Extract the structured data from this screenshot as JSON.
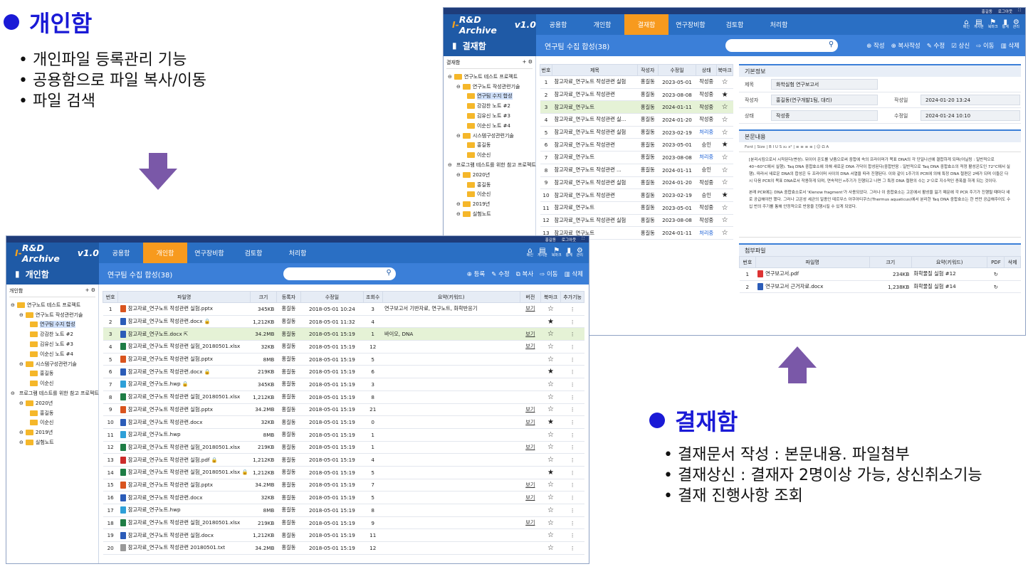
{
  "slide": {
    "personal_title": "개인함",
    "personal_bullets": [
      "개인파일 등록관리 기능",
      "공용함으로 파일 복사/이동",
      "파일 검색"
    ],
    "approval_title": "결재함",
    "approval_bullets": [
      "결재문서 작성 : 본문내용. 파일첨부",
      "결재상신 : 결재자 2명이상 가능, 상신취소기능",
      "결재 진행사항 조회"
    ]
  },
  "app": {
    "logo_prefix": "I-",
    "logo_main": "R&D Archive",
    "logo_ver": "v1.0",
    "user": "홍길동",
    "logout": "로그아웃"
  },
  "nav_personal": [
    "공용함",
    "개인함",
    "연구장비함",
    "검토함",
    "처리함"
  ],
  "nav_approval": [
    "공용함",
    "개인함",
    "결재함",
    "연구장비함",
    "검토함",
    "처리함"
  ],
  "navicons": [
    {
      "icon": "home-icon",
      "glyph": "⌂",
      "label": "메인"
    },
    {
      "icon": "board-icon",
      "glyph": "▤",
      "label": "게시판"
    },
    {
      "icon": "bookmark-icon",
      "glyph": "⚑",
      "label": "북마크"
    },
    {
      "icon": "stats-icon",
      "glyph": "▮",
      "label": "통계"
    },
    {
      "icon": "gear-icon",
      "glyph": "⚙",
      "label": "관리"
    }
  ],
  "personal": {
    "section": "개인함",
    "subtitle": "연구팀 수집 합성(38)",
    "toolbar": [
      "등록",
      "수정",
      "복사",
      "이동",
      "삭제"
    ],
    "tree_header": "개인함",
    "tree": [
      {
        "d": 0,
        "t": "연구노트 테스트 프로젝트"
      },
      {
        "d": 1,
        "t": "연구노트 작성관련기술"
      },
      {
        "d": 2,
        "t": "연구팀 수지 합성",
        "sel": true
      },
      {
        "d": 2,
        "t": "강감찬 노트 #2"
      },
      {
        "d": 2,
        "t": "김유신 노트 #3"
      },
      {
        "d": 2,
        "t": "이순신 노트 #4"
      },
      {
        "d": 1,
        "t": "시스템구성관련기술"
      },
      {
        "d": 2,
        "t": "홍길동"
      },
      {
        "d": 2,
        "t": "이순신"
      },
      {
        "d": 0,
        "t": "프로그램 테스트를 위한 참고 프로젝트"
      },
      {
        "d": 1,
        "t": "2020년"
      },
      {
        "d": 2,
        "t": "홍길동"
      },
      {
        "d": 2,
        "t": "이순신"
      },
      {
        "d": 1,
        "t": "2019년"
      },
      {
        "d": 1,
        "t": "실험노트"
      }
    ],
    "columns": [
      "번호",
      "파일명",
      "크기",
      "등록자",
      "수정일",
      "조회수",
      "요약(키워드)",
      "버전",
      "북마크",
      "추가기능"
    ],
    "rows": [
      [
        "1",
        "참고자료_연구노트 작성관련 실험.pptx",
        "345KB",
        "홍길동",
        "2018-05-01 10:24",
        "3",
        "연구보고서 기반자료, 연구노트, 화학반응기",
        "보기",
        "☆",
        "p",
        ""
      ],
      [
        "2",
        "참고자료_연구노트 작성관련.docx",
        "1,212KB",
        "홍길동",
        "2018-05-01 11:32",
        "4",
        "",
        "",
        "★",
        "w",
        "lock"
      ],
      [
        "3",
        "참고자료_연구노트.docx",
        "34.2MB",
        "홍길동",
        "2018-05-01 15:19",
        "1",
        "바이오, DNA",
        "보기",
        "☆",
        "w",
        "share"
      ],
      [
        "4",
        "참고자료_연구노트 작성관련 실험_20180501.xlsx",
        "32KB",
        "홍길동",
        "2018-05-01 15:19",
        "12",
        "",
        "보기",
        "☆",
        "x",
        ""
      ],
      [
        "5",
        "참고자료_연구노트 작성관련 실험.pptx",
        "8MB",
        "홍길동",
        "2018-05-01 15:19",
        "5",
        "",
        "",
        "☆",
        "p",
        ""
      ],
      [
        "6",
        "참고자료_연구노트 작성관련.docx",
        "219KB",
        "홍길동",
        "2018-05-01 15:19",
        "6",
        "",
        "",
        "★",
        "w",
        "lock"
      ],
      [
        "7",
        "참고자료_연구노트.hwp",
        "345KB",
        "홍길동",
        "2018-05-01 15:19",
        "3",
        "",
        "",
        "☆",
        "h",
        "lock"
      ],
      [
        "8",
        "참고자료_연구노트 작성관련 실험_20180501.xlsx",
        "1,212KB",
        "홍길동",
        "2018-05-01 15:19",
        "8",
        "",
        "",
        "☆",
        "x",
        ""
      ],
      [
        "9",
        "참고자료_연구노트 작성관련 실험.pptx",
        "34.2MB",
        "홍길동",
        "2018-05-01 15:19",
        "21",
        "",
        "보기",
        "☆",
        "p",
        ""
      ],
      [
        "10",
        "참고자료_연구노트 작성관련.docx",
        "32KB",
        "홍길동",
        "2018-05-01 15:19",
        "0",
        "",
        "보기",
        "★",
        "w",
        ""
      ],
      [
        "11",
        "참고자료_연구노트.hwp",
        "8MB",
        "홍길동",
        "2018-05-01 15:19",
        "1",
        "",
        "",
        "☆",
        "h",
        ""
      ],
      [
        "12",
        "참고자료_연구노트 작성관련 실험_20180501.xlsx",
        "219KB",
        "홍길동",
        "2018-05-01 15:19",
        "1",
        "",
        "보기",
        "☆",
        "x",
        ""
      ],
      [
        "13",
        "참고자료_연구노트 작성관련 실험.pdf",
        "1,212KB",
        "홍길동",
        "2018-05-01 15:19",
        "4",
        "",
        "",
        "☆",
        "pdf",
        "lock"
      ],
      [
        "14",
        "참고자료_연구노트 작성관련 실험_20180501.xlsx",
        "1,212KB",
        "홍길동",
        "2018-05-01 15:19",
        "5",
        "",
        "",
        "★",
        "x",
        "lock"
      ],
      [
        "15",
        "참고자료_연구노트 작성관련 실험.pptx",
        "34.2MB",
        "홍길동",
        "2018-05-01 15:19",
        "7",
        "",
        "보기",
        "☆",
        "p",
        ""
      ],
      [
        "16",
        "참고자료_연구노트 작성관련.docx",
        "32KB",
        "홍길동",
        "2018-05-01 15:19",
        "5",
        "",
        "보기",
        "☆",
        "w",
        ""
      ],
      [
        "17",
        "참고자료_연구노트.hwp",
        "8MB",
        "홍길동",
        "2018-05-01 15:19",
        "8",
        "",
        "",
        "☆",
        "h",
        ""
      ],
      [
        "18",
        "참고자료_연구노트 작성관련 실험_20180501.xlsx",
        "219KB",
        "홍길동",
        "2018-05-01 15:19",
        "9",
        "",
        "보기",
        "☆",
        "x",
        ""
      ],
      [
        "19",
        "참고자료_연구노트 작성관련 실험.docx",
        "1,212KB",
        "홍길동",
        "2018-05-01 15:19",
        "11",
        "",
        "",
        "☆",
        "w",
        ""
      ],
      [
        "20",
        "참고자료_연구노트 작성관련 20180501.txt",
        "34.2MB",
        "홍길동",
        "2018-05-01 15:19",
        "12",
        "",
        "",
        "☆",
        "t",
        ""
      ]
    ]
  },
  "approval": {
    "section": "결재함",
    "subtitle": "연구팀 수집 합성(38)",
    "toolbar": [
      "작성",
      "복사작성",
      "수정",
      "상신",
      "이동",
      "삭제"
    ],
    "tree_header": "결재함",
    "tree": [
      {
        "d": 0,
        "t": "연구노트 테스트 프로젝트"
      },
      {
        "d": 1,
        "t": "연구노트 작성관련기술"
      },
      {
        "d": 2,
        "t": "연구팀 수지 합성",
        "sel": true
      },
      {
        "d": 2,
        "t": "강감찬 노트 #2"
      },
      {
        "d": 2,
        "t": "김유신 노트 #3"
      },
      {
        "d": 2,
        "t": "이순신 노트 #4"
      },
      {
        "d": 1,
        "t": "시스템구성관련기술"
      },
      {
        "d": 2,
        "t": "홍길동"
      },
      {
        "d": 2,
        "t": "이순신"
      },
      {
        "d": 0,
        "t": "프로그램 테스트를 위한 참고 프로젝트"
      },
      {
        "d": 1,
        "t": "2020년"
      },
      {
        "d": 2,
        "t": "홍길동"
      },
      {
        "d": 2,
        "t": "이순신"
      },
      {
        "d": 1,
        "t": "2019년"
      },
      {
        "d": 1,
        "t": "실험노트"
      }
    ],
    "columns": [
      "번호",
      "제목",
      "작성자",
      "수정일",
      "상태",
      "북마크"
    ],
    "rows": [
      [
        "1",
        "참고자료_연구노트 작성관련 실험",
        "홍길동",
        "2023-05-01",
        "작성중",
        "☆"
      ],
      [
        "2",
        "참고자료_연구노트 작성관련",
        "홍길동",
        "2023-08-08",
        "작성중",
        "★"
      ],
      [
        "3",
        "참고자료_연구노트",
        "홍길동",
        "2024-01-11",
        "작성중",
        "☆"
      ],
      [
        "4",
        "참고자료_연구노트 작성관련 실...",
        "홍길동",
        "2024-01-20",
        "작성중",
        "☆"
      ],
      [
        "5",
        "참고자료_연구노트 작성관련 실험",
        "홍길동",
        "2023-02-19",
        "처리중",
        "☆"
      ],
      [
        "6",
        "참고자료_연구노트 작성관련",
        "홍길동",
        "2023-05-01",
        "승인",
        "★"
      ],
      [
        "7",
        "참고자료_연구노트",
        "홍길동",
        "2023-08-08",
        "처리중",
        "☆"
      ],
      [
        "8",
        "참고자료_연구노트 작성관련 ...",
        "홍길동",
        "2024-01-11",
        "승인",
        "☆"
      ],
      [
        "9",
        "참고자료_연구노트 작성관련 실험",
        "홍길동",
        "2024-01-20",
        "작성중",
        "☆"
      ],
      [
        "10",
        "참고자료_연구노트 작성관련",
        "홍길동",
        "2023-02-19",
        "승인",
        "★"
      ],
      [
        "11",
        "참고자료_연구노트",
        "홍길동",
        "2023-05-01",
        "작성중",
        "☆"
      ],
      [
        "12",
        "참고자료_연구노트 작성관련 실험",
        "홍길동",
        "2023-08-08",
        "작성중",
        "☆"
      ],
      [
        "13",
        "참고자료_연구노트",
        "홍길동",
        "2024-01-11",
        "처리중",
        "☆"
      ]
    ],
    "info_header": "기본정보",
    "info": {
      "title_k": "제목",
      "title_v": "화학실험 연구보고서",
      "author_k": "작성자",
      "author_v": "홍길동(연구개발1팀, 대리)",
      "date_k": "작성일",
      "date_v": "2024-01-20 13:24",
      "state_k": "상태",
      "state_v": "작성중",
      "mod_k": "수정일",
      "mod_v": "2024-01-24 10:10"
    },
    "body_header": "본문내용",
    "body_text": "[분리시킴으로서 시작된다(변성). 뒤이어 온도를 낮춤으로써 중합에 속의 프라이머가 목표 DNA의 각 단일나선에 결합하게 되며(어닐링 : 일반적으로 40~60°C에서 실행). Taq DNA 중합효소에 의해 새로운 DNA 가닥이 합성된다(중합반응 : 일반적으로 Taq DNA 중합효소의 적정 활성온도인 72°C에서 실행). 따라서 새로운 DNA의 합성은 두 프라이머 사이의 DNA 서열을 따라 진행된다. 이와 같이 1주기의 PCR에 의해 특정 DNA 절편은 2배가 되며 이들은 다시 다음 PCR의 목표 DNA로서 작용하게 되며, 연속적인 n주기가 진행되고 나면 그 특정 DNA 절편의 수는 2ⁿ으로 지수적인 증폭을 하게 되는 것이다.",
    "body_text2": "본래 PCR에는 DNA 중합효소로서 'Klenow fragment'가 사용되었다. 그러나 이 중합효소는 고온에서 활성을 잃기 때문에 각 PCR 주기가 진행될 때마다 새로 공급해야만 했다. 그러나 고온성 세균의 일종인 테르무스 아쿠아티쿠스(Thermus aquaticus)에서 분리한 Taq DNA 중합효소는 한 번만 공급해주어도 수십 번의 주기를 통해 안정적으로 반응을 진행시킬 수 있게 되었다.",
    "attach_header": "첨부파일",
    "attach_columns": [
      "번호",
      "파일명",
      "크기",
      "요약(키워드)",
      "PDF",
      "삭제"
    ],
    "attachments": [
      [
        "1",
        "연구보고서.pdf",
        "234KB",
        "화학물질 실험 #12"
      ],
      [
        "2",
        "연구보고서 근거자료.docx",
        "1,238KB",
        "화학물질 실험 #14"
      ]
    ]
  }
}
